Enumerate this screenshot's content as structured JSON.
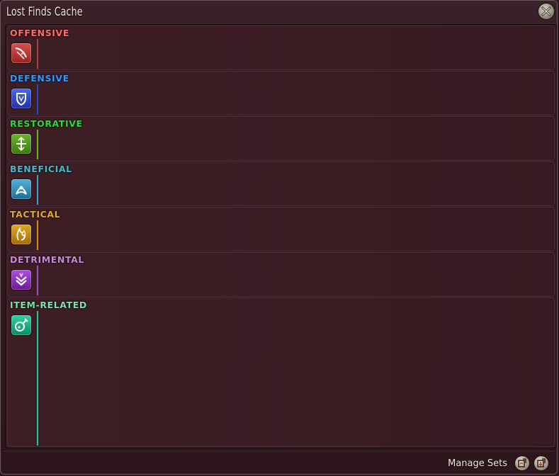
{
  "window": {
    "title": "Lost Finds Cache",
    "close_icon": "close-x-icon"
  },
  "categories": [
    {
      "label": "OFFENSIVE",
      "color": "#ff6e6e",
      "line_color": "#a8403f",
      "icon": "offensive-slash-icon",
      "icon_bg": "#b8302c"
    },
    {
      "label": "DEFENSIVE",
      "color": "#2e9bff",
      "line_color": "#2c47c8",
      "icon": "defensive-shield-icon",
      "icon_bg": "#2a3fc0"
    },
    {
      "label": "RESTORATIVE",
      "color": "#2fd83a",
      "line_color": "#67b81f",
      "icon": "restorative-arrows-icon",
      "icon_bg": "#4e8f1c"
    },
    {
      "label": "BENEFICIAL",
      "color": "#4db7c9",
      "line_color": "#3f9fd0",
      "icon": "beneficial-crest-icon",
      "icon_bg": "#2b86b0"
    },
    {
      "label": "TACTICAL",
      "color": "#e3a93a",
      "line_color": "#d28a16",
      "icon": "tactical-flame-icon",
      "icon_bg": "#c58a12"
    },
    {
      "label": "DETRIMENTAL",
      "color": "#c78ad8",
      "line_color": "#a34bc4",
      "icon": "detrimental-chevron-icon",
      "icon_bg": "#8a2ab4"
    },
    {
      "label": "ITEM-RELATED",
      "color": "#7fe0b0",
      "line_color": "#1fc79a",
      "icon": "item-flask-icon",
      "icon_bg": "#18b48a"
    }
  ],
  "footer": {
    "manage_sets_label": "Manage Sets",
    "buttons": [
      "save-set-icon",
      "load-set-icon"
    ]
  }
}
